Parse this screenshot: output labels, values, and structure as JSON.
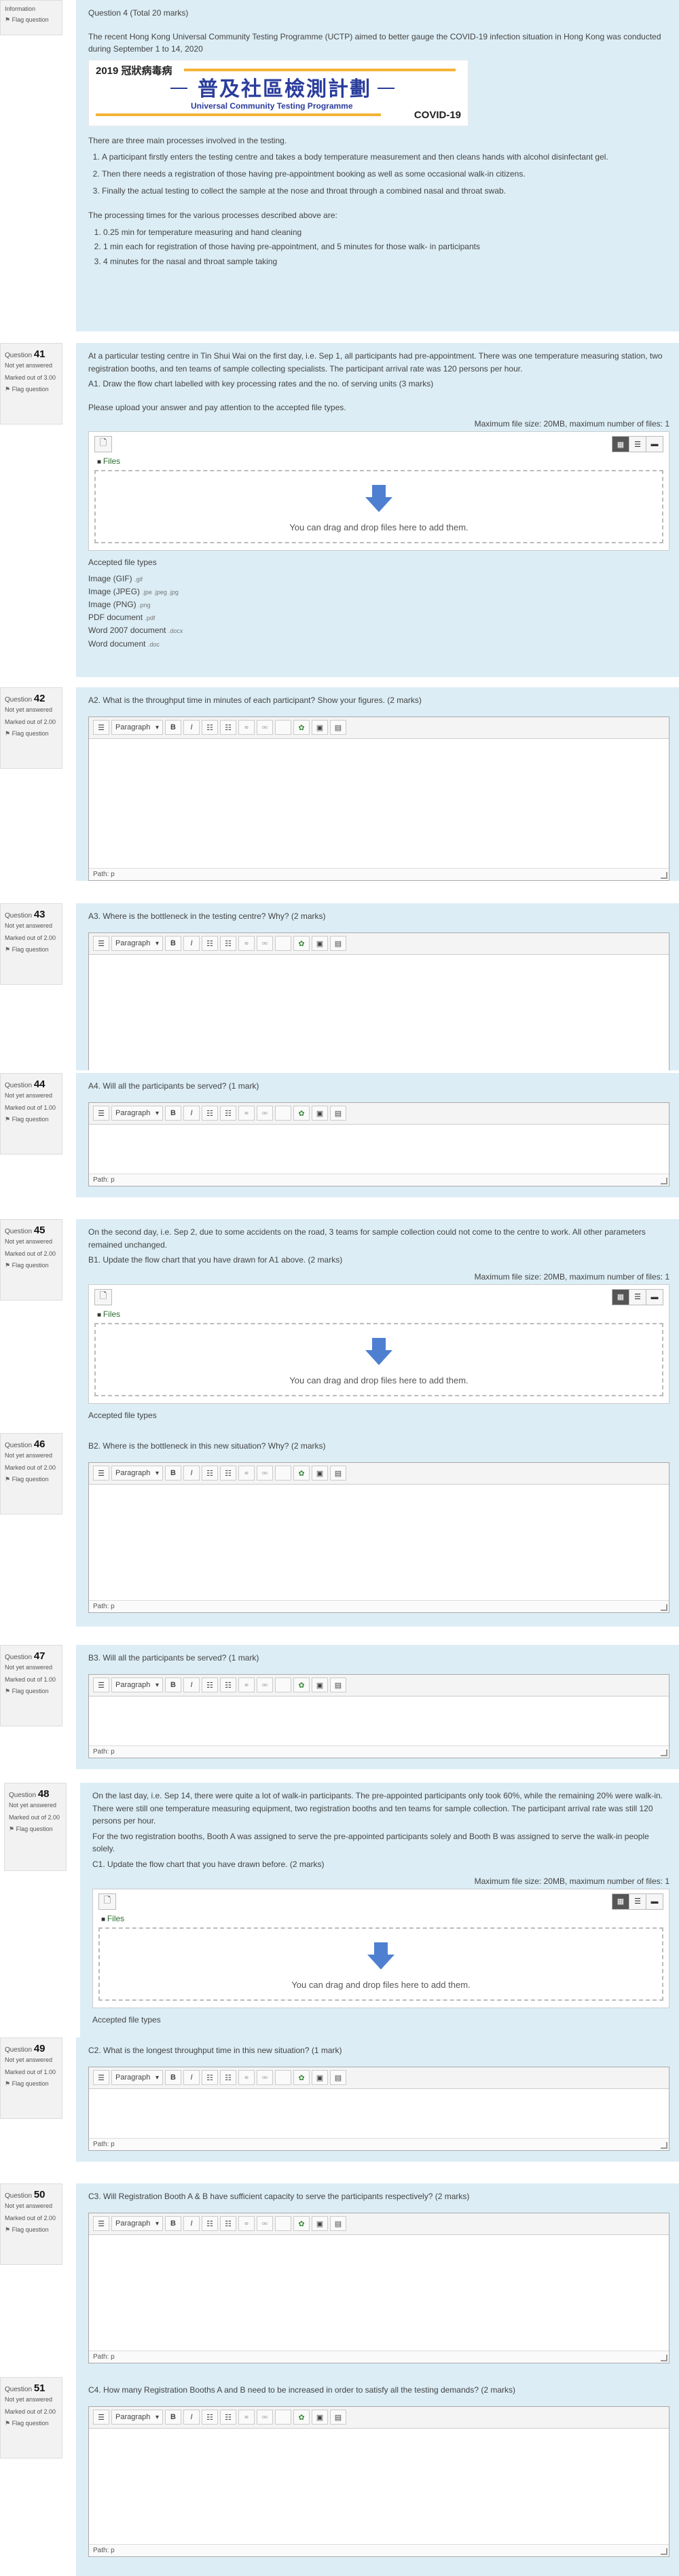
{
  "q40": {
    "info_label": "Information",
    "flag": "Flag question",
    "heading": "Question 4   (Total 20 marks)",
    "intro": "The recent Hong Kong Universal Community Testing Programme (UCTP) aimed to better gauge the COVID-19 infection situation in Hong Kong was conducted during September 1 to 14, 2020",
    "banner": {
      "year": "2019 冠狀病毒病",
      "title_zh": "普及社區檢測計劃",
      "title_en": "Universal Community Testing Programme",
      "covid": "COVID-19"
    },
    "processes_intro": "There are three main processes involved in the testing.",
    "processes": [
      "A participant firstly enters the testing centre and takes a body temperature measurement and then cleans hands with alcohol disinfectant gel.",
      "Then there needs a registration of those having pre-appointment booking as well as some occasional walk-in citizens.",
      "Finally the actual testing to collect the sample at the nose and throat through a combined nasal and throat swab."
    ],
    "times_intro": "The processing times for the various processes described above are:",
    "times": [
      "0.25 min for temperature measuring and hand cleaning",
      "1 min each for registration of those having pre-appointment, and 5 minutes for those walk- in participants",
      "4 minutes for the nasal and throat sample taking"
    ]
  },
  "questions": [
    {
      "num": "41",
      "status": "Not yet answered",
      "marked": "Marked out of 3.00",
      "flag": "Flag question",
      "text1": "At a particular testing centre in Tin Shui Wai on the first day, i.e. Sep 1, all participants had pre-appointment. There was one temperature measuring station, two registration booths, and ten teams of sample collecting specialists. The participant arrival rate was 120 persons per hour.",
      "text2": "A1. Draw the flow chart labelled with key processing rates and the no. of serving units (3 marks)",
      "text3": "Please upload your answer and pay attention to the accepted file types.",
      "maxsize": "Maximum file size: 20MB, maximum number of files: 1",
      "files": "Files",
      "dz": "You can drag and drop files here to add them.",
      "accepted_title": "Accepted file types",
      "accepted": [
        {
          "name": "Image (GIF)",
          "ext": ".gif"
        },
        {
          "name": "Image (JPEG)",
          "ext": ".jpe .jpeg .jpg"
        },
        {
          "name": "Image (PNG)",
          "ext": ".png"
        },
        {
          "name": "PDF document",
          "ext": ".pdf"
        },
        {
          "name": "Word 2007 document",
          "ext": ".docx"
        },
        {
          "name": "Word document",
          "ext": ".doc"
        }
      ]
    },
    {
      "num": "42",
      "status": "Not yet answered",
      "marked": "Marked out of 2.00",
      "flag": "Flag question",
      "text": "A2. What is the throughput time in minutes of each participant?  Show your figures. (2 marks)"
    },
    {
      "num": "43",
      "status": "Not yet answered",
      "marked": "Marked out of 2.00",
      "flag": "Flag question",
      "text": "A3. Where is the bottleneck in the testing centre? Why? (2 marks)"
    },
    {
      "num": "44",
      "status": "Not yet answered",
      "marked": "Marked out of 1.00",
      "flag": "Flag question",
      "text": "A4. Will all the participants be served? (1 mark)"
    },
    {
      "num": "45",
      "status": "Not yet answered",
      "marked": "Marked out of 2.00",
      "flag": "Flag question",
      "text1": "On the second day, i.e. Sep 2, due to some accidents on the road, 3 teams for sample collection could not come to the centre to work. All other parameters remained unchanged.",
      "text2": "B1. Update the flow chart that you have drawn for A1 above. (2 marks)",
      "maxsize": "Maximum file size: 20MB, maximum number of files: 1",
      "files": "Files",
      "dz": "You can drag and drop files here to add them.",
      "accepted_title": "Accepted file types"
    },
    {
      "num": "46",
      "status": "Not yet answered",
      "marked": "Marked out of 2.00",
      "flag": "Flag question",
      "text": "B2. Where is the bottleneck in this new situation? Why?  (2 marks)"
    },
    {
      "num": "47",
      "status": "Not yet answered",
      "marked": "Marked out of 1.00",
      "flag": "Flag question",
      "text": "B3. Will all the participants be served?  (1 mark)"
    },
    {
      "num": "48",
      "status": "Not yet answered",
      "marked": "Marked out of 2.00",
      "flag": "Flag question",
      "text1": "On the last day, i.e. Sep 14, there were quite a lot of walk-in participants. The pre-appointed participants only took 60%, while the remaining 20% were walk-in. There were still one temperature measuring equipment, two registration booths and ten teams for sample collection. The participant arrival rate was still 120 persons per hour.",
      "text2": "For the two registration booths, Booth A was assigned to serve the pre-appointed participants solely and Booth B was assigned to serve the walk-in people solely.",
      "text3": "C1. Update the flow chart that you have drawn before. (2 marks)",
      "maxsize": "Maximum file size: 20MB, maximum number of files: 1",
      "files": "Files",
      "dz": "You can drag and drop files here to add them.",
      "accepted_title": "Accepted file types"
    },
    {
      "num": "49",
      "status": "Not yet answered",
      "marked": "Marked out of 1.00",
      "flag": "Flag question",
      "text": "C2. What is the longest throughput time in this new situation?  (1 mark)"
    },
    {
      "num": "50",
      "status": "Not yet answered",
      "marked": "Marked out of 2.00",
      "flag": "Flag question",
      "text": "C3. Will Registration Booth A & B have sufficient capacity to serve the participants respectively?  (2 marks)"
    },
    {
      "num": "51",
      "status": "Not yet answered",
      "marked": "Marked out of 2.00",
      "flag": "Flag question",
      "text": "C4. How many Registration Booths A and B need to be increased in order to satisfy all the testing demands?  (2 marks)"
    }
  ],
  "editor": {
    "paragraph": "Paragraph",
    "path": "Path: p"
  },
  "question_label": "Question"
}
